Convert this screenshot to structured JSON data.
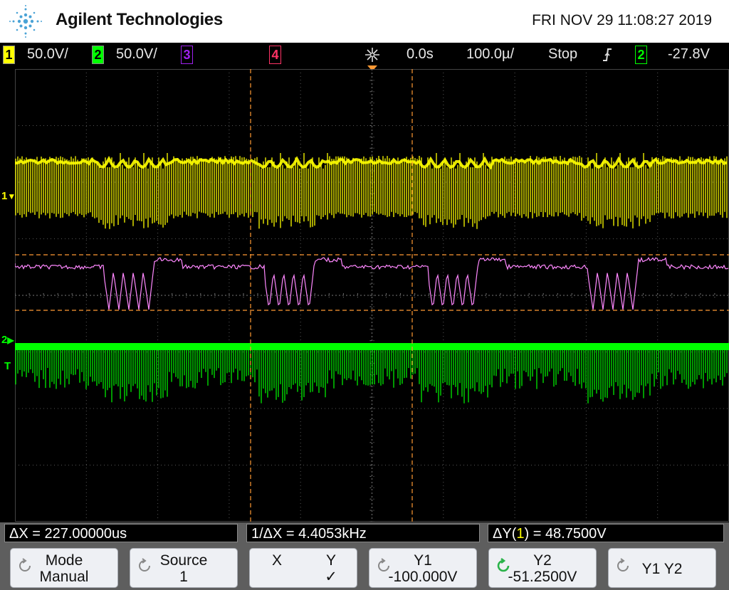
{
  "header": {
    "brand": "Agilent Technologies",
    "datetime": "FRI NOV 29 11:08:27 2019"
  },
  "status_bar": {
    "ch1": {
      "number": "1",
      "scale": "50.0V/",
      "color": "#ffff00"
    },
    "ch2": {
      "number": "2",
      "scale": "50.0V/",
      "color": "#00ff00"
    },
    "ch3": {
      "number": "3",
      "color": "#a020f0"
    },
    "ch4": {
      "number": "4",
      "color": "#ff3366"
    },
    "delay": "0.0s",
    "timebase": "100.0µ/",
    "run_state": "Stop",
    "trigger_slope_icon": "rising-edge-icon",
    "trigger_source": "2",
    "trigger_level": "-27.8V"
  },
  "markers": {
    "ch1": "1",
    "ch2": "2",
    "trigger": "T"
  },
  "measurements": {
    "delta_x": "ΔX = 227.00000us",
    "inv_delta_x": "1/ΔX = 4.4053kHz",
    "delta_y_prefix": "ΔY(",
    "delta_y_ch": "1",
    "delta_y_suffix": ") = 48.7500V"
  },
  "softkeys": {
    "mode": {
      "line1": "Mode",
      "line2": "Manual"
    },
    "source": {
      "line1": "Source",
      "line2": "1"
    },
    "xy": {
      "x": "X",
      "y": "Y",
      "check": "✓"
    },
    "y1": {
      "line1": "Y1",
      "line2": "-100.000V"
    },
    "y2": {
      "line1": "Y2",
      "line2": "-51.2500V"
    },
    "y1y2": {
      "line1": "Y1 Y2"
    }
  },
  "colors": {
    "ch1": "#ffff00",
    "ch2": "#00ff00",
    "math": "#ff88ff",
    "cursor": "#ff9933",
    "grid": "#555555",
    "softkey_arrow": "#2bb34a"
  }
}
